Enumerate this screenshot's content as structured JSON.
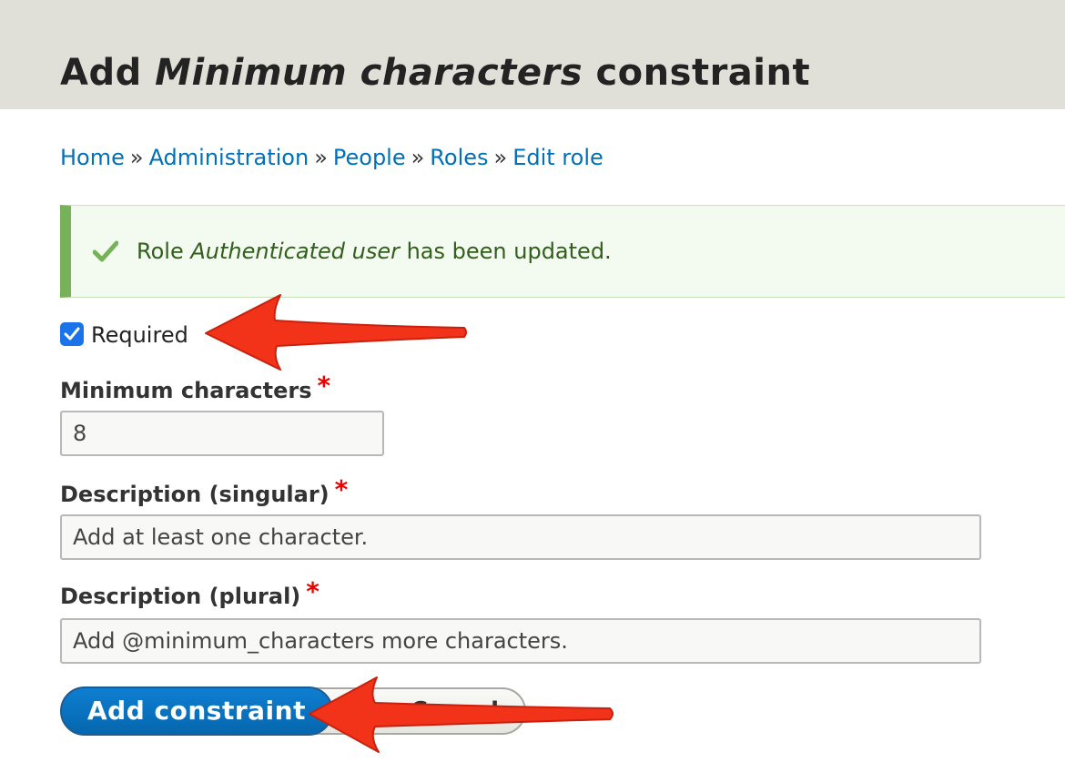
{
  "header": {
    "title_prefix": "Add",
    "title_emphasis": "Minimum characters",
    "title_suffix": "constraint"
  },
  "breadcrumb": {
    "items": [
      "Home",
      "Administration",
      "People",
      "Roles",
      "Edit role"
    ],
    "separator": "»"
  },
  "status_message": {
    "prefix": "Role",
    "role_name": "Authenticated user",
    "suffix": "has been updated.",
    "icon": "checkmark-icon",
    "colors": {
      "accent": "#77b259",
      "background": "#f3faef",
      "text": "#325e1c"
    }
  },
  "form": {
    "required_checkbox": {
      "label": "Required",
      "checked": true
    },
    "min_chars": {
      "label": "Minimum characters",
      "value": "8",
      "required_marker": "*"
    },
    "desc_singular": {
      "label": "Description (singular)",
      "value": "Add at least one character.",
      "required_marker": "*"
    },
    "desc_plural": {
      "label": "Description (plural)",
      "value": "Add @minimum_characters more characters.",
      "required_marker": "*"
    },
    "submit_label": "Add constraint",
    "secondary_label": "Cancel"
  },
  "annotations": {
    "arrow_color": "#f3321a",
    "arrow_icon": "red-arrow-icon"
  }
}
